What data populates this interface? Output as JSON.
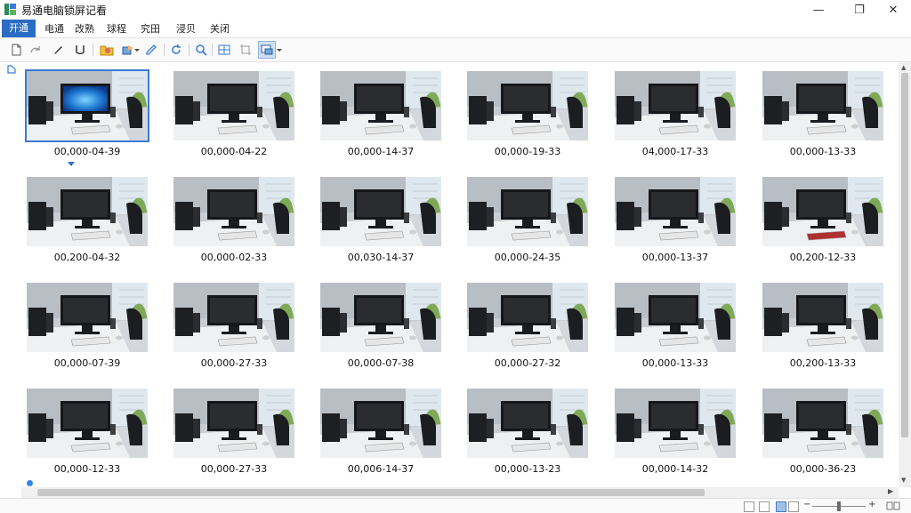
{
  "window": {
    "title": "易通电脑锁屏记看",
    "minimize_glyph": "—",
    "maximize_glyph": "❐",
    "close_glyph": "✕"
  },
  "menu": {
    "items": [
      {
        "label": "开通"
      },
      {
        "label": "电通"
      },
      {
        "label": "改熟"
      },
      {
        "label": "球程"
      },
      {
        "label": "究田"
      },
      {
        "label": "浸贝"
      },
      {
        "label": "关闭"
      }
    ]
  },
  "toolbar": {
    "icons": [
      "new-file-icon",
      "redo-icon",
      "pen-icon",
      "bracket-icon",
      "folder-icon",
      "export-icon",
      "edit-icon",
      "refresh-icon",
      "zoom-icon",
      "grid-icon",
      "crop-icon",
      "window-icon"
    ]
  },
  "thumbnails": [
    {
      "label": "00,000-04-39",
      "screen": "on"
    },
    {
      "label": "00,000-04-22"
    },
    {
      "label": "00,000-14-37"
    },
    {
      "label": "00,000-19-33"
    },
    {
      "label": "04,000-17-33"
    },
    {
      "label": "00,000-13-33"
    },
    {
      "label": "00,200-04-32"
    },
    {
      "label": "00,000-02-33"
    },
    {
      "label": "00,030-14-37"
    },
    {
      "label": "00,000-24-35"
    },
    {
      "label": "00,000-13-37"
    },
    {
      "label": "00,200-12-33",
      "keyboard": "red"
    },
    {
      "label": "00,000-07-39"
    },
    {
      "label": "00,000-27-33"
    },
    {
      "label": "00,000-07-38"
    },
    {
      "label": "00,000-27-32"
    },
    {
      "label": "00,000-13-33"
    },
    {
      "label": "00,200-13-33"
    },
    {
      "label": "00,000-12-33"
    },
    {
      "label": "00,000-27-33"
    },
    {
      "label": "00,006-14-37"
    },
    {
      "label": "00,000-13-23"
    },
    {
      "label": "00,000-14-32"
    },
    {
      "label": "00,000-36-23"
    }
  ],
  "colors": {
    "accent": "#2b6cc4",
    "selection": "#3a7bd5"
  }
}
